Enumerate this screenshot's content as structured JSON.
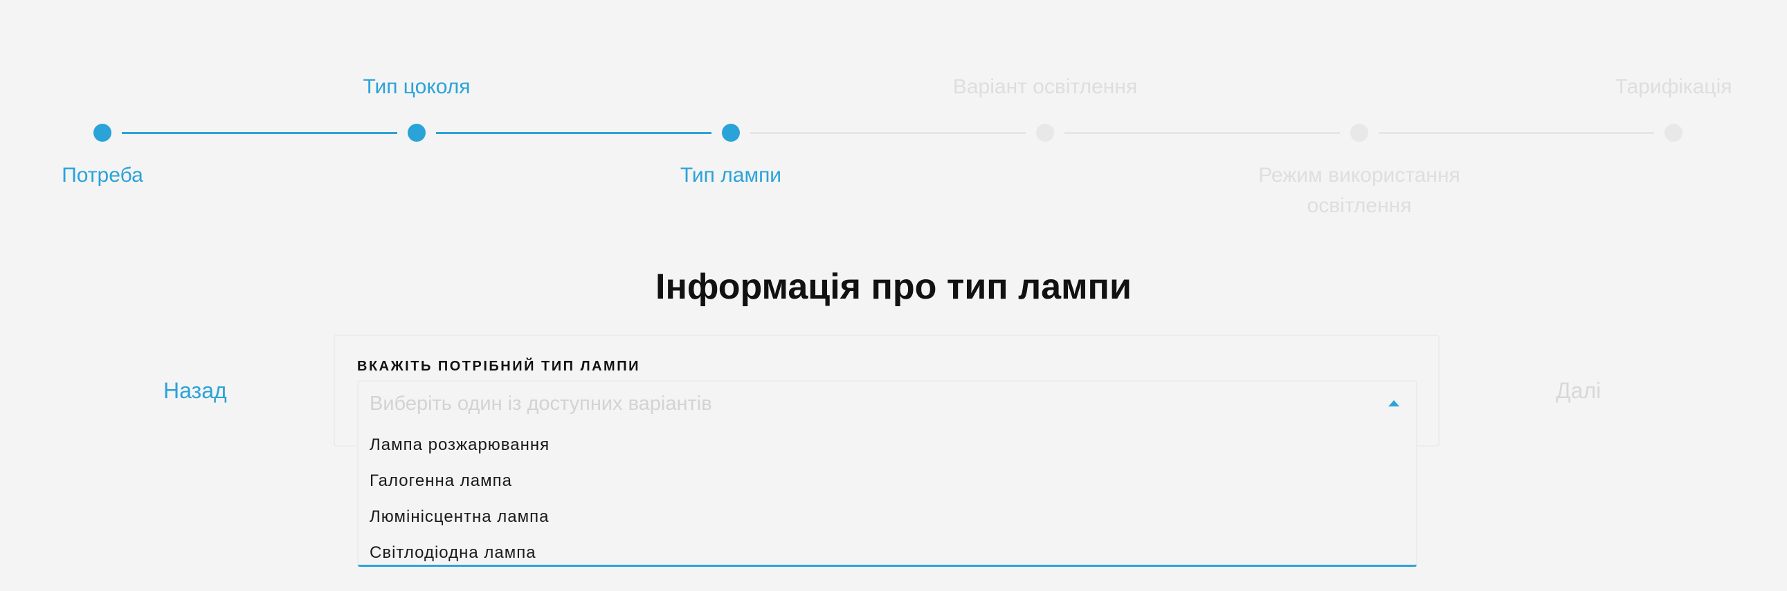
{
  "stepper": {
    "steps": [
      {
        "label": "Потреба",
        "state": "done"
      },
      {
        "label": "Тип цоколя",
        "state": "done"
      },
      {
        "label": "Тип лампи",
        "state": "current"
      },
      {
        "label": "Варіант освітлення",
        "state": "pending"
      },
      {
        "label": "Режим використання освітлення",
        "state": "pending"
      },
      {
        "label": "Тарифікація",
        "state": "pending"
      }
    ]
  },
  "main": {
    "title": "Інформація про тип лампи"
  },
  "nav": {
    "back_label": "Назад",
    "next_label": "Далі"
  },
  "form": {
    "field_label": "ВКАЖІТЬ ПОТРІБНИЙ ТИП ЛАМПИ",
    "select": {
      "placeholder": "Виберіть один із доступних варіантів",
      "options": [
        "Лампа розжарювання",
        "Галогенна лампа",
        "Люмінісцентна лампа",
        "Світлодіодна лампа"
      ]
    }
  },
  "colors": {
    "accent": "#2aa3d8",
    "inactive": "#e6e6e6",
    "background": "#f4f4f4"
  },
  "icons": {
    "select_caret": "caret-up-icon"
  }
}
